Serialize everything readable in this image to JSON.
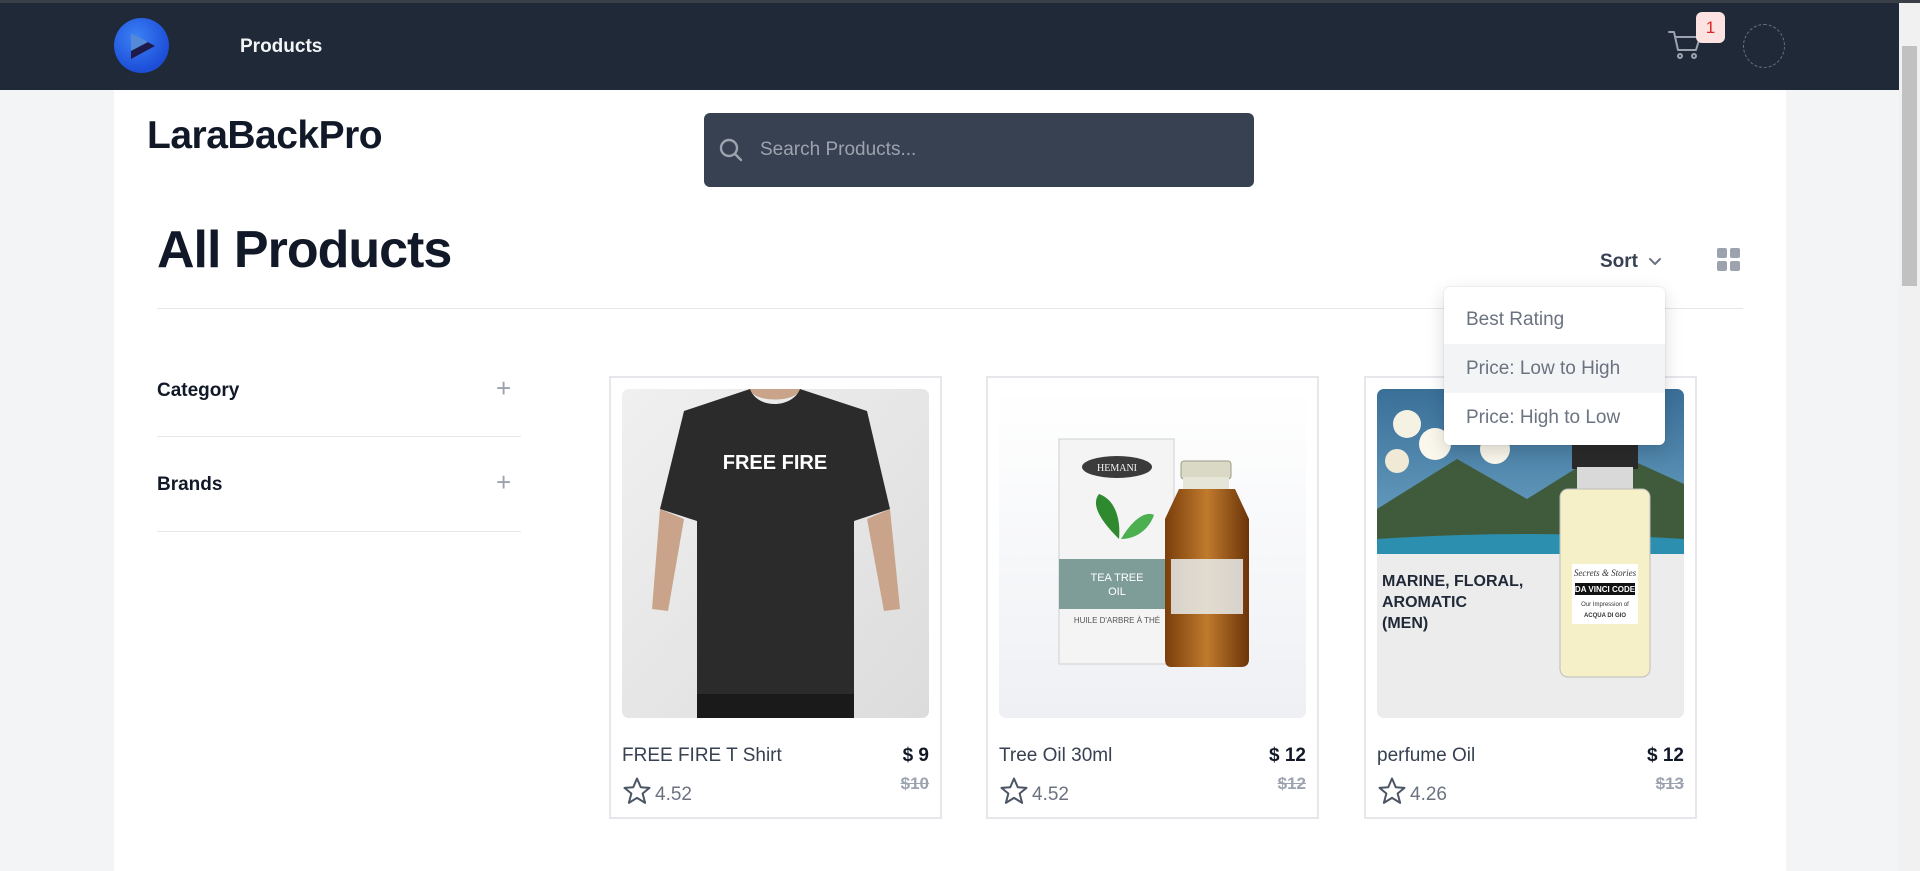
{
  "nav": {
    "logo_icon": "play-logo-icon",
    "products_link": "Products",
    "cart_icon": "cart-icon",
    "cart_count": "1",
    "avatar_icon": "avatar"
  },
  "brand": {
    "name": "LaraBackPro"
  },
  "search": {
    "placeholder": "Search Products...",
    "icon": "search-icon"
  },
  "page": {
    "title": "All Products"
  },
  "toolbar": {
    "sort_label": "Sort",
    "sort_icon": "chevron-down-icon",
    "grid_icon": "grid-view-icon"
  },
  "sort_menu": {
    "options": [
      "Best Rating",
      "Price: Low to High",
      "Price: High to Low"
    ],
    "highlighted": "Price: Low to High"
  },
  "filters": [
    {
      "label": "Category",
      "icon": "plus-icon"
    },
    {
      "label": "Brands",
      "icon": "plus-icon"
    }
  ],
  "products": [
    {
      "name": "FREE FIRE T Shirt",
      "price": "$ 9",
      "old_price": "$10",
      "rating": "4.52",
      "image_text": "FREE FIRE"
    },
    {
      "name": "Tree Oil 30ml",
      "price": "$ 12",
      "old_price": "$12",
      "rating": "4.52",
      "image_text": [
        "HEMANI",
        "TEA TREE",
        "OIL",
        "HUILE D'ARBRE À THÉ"
      ]
    },
    {
      "name": "perfume Oil",
      "price": "$ 12",
      "old_price": "$13",
      "rating": "4.26",
      "image_text": [
        "MARINE, FLORAL,",
        "AROMATIC",
        "(MEN)",
        "Secrets & Stories",
        "DA VINCI CODE",
        "Our Impression of",
        "ACQUA DI GIO"
      ]
    }
  ],
  "colors": {
    "nav_bg": "#1f2937",
    "search_bg": "#374151",
    "badge_bg": "#fde2e2",
    "badge_text": "#dc2626"
  }
}
